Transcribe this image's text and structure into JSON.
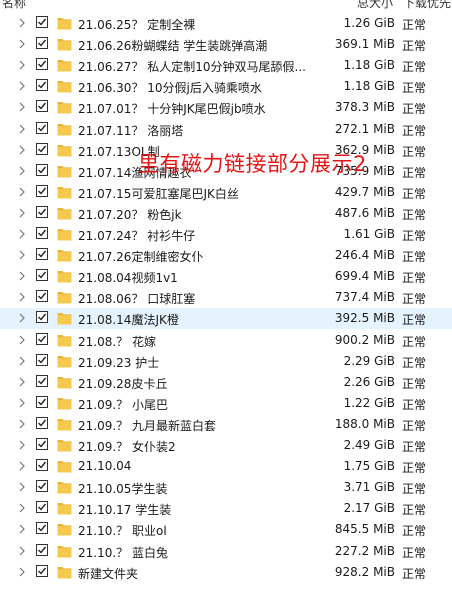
{
  "header": {
    "name_col": "名称",
    "size_col": "总大小",
    "status_col": "下载优先"
  },
  "watermark": "里有磁力链接部分展示2",
  "selected_index": 14,
  "items": [
    {
      "name": "21.06.25？ 定制全裸",
      "size": "1.26 GiB",
      "status": "正常"
    },
    {
      "name": "21.06.26粉蝴蝶结 学生装跳弹高潮",
      "size": "369.1 MiB",
      "status": "正常"
    },
    {
      "name": "21.06.27？ 私人定制10分钟双马尾舔假...",
      "size": "1.18 GiB",
      "status": "正常"
    },
    {
      "name": "21.06.30？ 10分假j后入骑乘喷水",
      "size": "1.18 GiB",
      "status": "正常"
    },
    {
      "name": "21.07.01？ 十分钟JK尾巴假jb喷水",
      "size": "378.3 MiB",
      "status": "正常"
    },
    {
      "name": "21.07.11？ 洛丽塔",
      "size": "272.1 MiB",
      "status": "正常"
    },
    {
      "name": "21.07.13OL制",
      "size": "362.9 MiB",
      "status": "正常"
    },
    {
      "name": "21.07.14渔网情趣衣",
      "size": "735.9 MiB",
      "status": "正常"
    },
    {
      "name": "21.07.15可爱肛塞尾巴JK白丝",
      "size": "429.7 MiB",
      "status": "正常"
    },
    {
      "name": "21.07.20？ 粉色jk",
      "size": "487.6 MiB",
      "status": "正常"
    },
    {
      "name": "21.07.24？ 衬衫牛仔",
      "size": "1.61 GiB",
      "status": "正常"
    },
    {
      "name": "21.07.26定制维密女仆",
      "size": "246.4 MiB",
      "status": "正常"
    },
    {
      "name": "21.08.04视频1v1",
      "size": "699.4 MiB",
      "status": "正常"
    },
    {
      "name": "21.08.06？ 口球肛塞",
      "size": "737.4 MiB",
      "status": "正常"
    },
    {
      "name": "21.08.14魔法JK橙",
      "size": "392.5 MiB",
      "status": "正常"
    },
    {
      "name": "21.08.？ 花嫁",
      "size": "900.2 MiB",
      "status": "正常"
    },
    {
      "name": "21.09.23 护士",
      "size": "2.29 GiB",
      "status": "正常"
    },
    {
      "name": "21.09.28皮卡丘",
      "size": "2.26 GiB",
      "status": "正常"
    },
    {
      "name": "21.09.？ 小尾巴",
      "size": "1.22 GiB",
      "status": "正常"
    },
    {
      "name": "21.09.？ 九月最新蓝白套",
      "size": "188.0 MiB",
      "status": "正常"
    },
    {
      "name": "21.09.？ 女仆装2",
      "size": "2.49 GiB",
      "status": "正常"
    },
    {
      "name": "21.10.04",
      "size": "1.75 GiB",
      "status": "正常"
    },
    {
      "name": "21.10.05学生装",
      "size": "3.71 GiB",
      "status": "正常"
    },
    {
      "name": "21.10.17 学生装",
      "size": "2.17 GiB",
      "status": "正常"
    },
    {
      "name": "21.10.？ 职业ol",
      "size": "845.5 MiB",
      "status": "正常"
    },
    {
      "name": "21.10.？ 蓝白兔",
      "size": "227.2 MiB",
      "status": "正常"
    },
    {
      "name": "新建文件夹",
      "size": "928.2 MiB",
      "status": "正常"
    }
  ],
  "icons": {
    "expand": "chevron-right-icon",
    "checkbox": "checkbox-checked-icon",
    "folder": "folder-icon"
  },
  "colors": {
    "folder": "#f5c94e",
    "selected_row": "#e5f3ff",
    "watermark": "#e51414"
  }
}
